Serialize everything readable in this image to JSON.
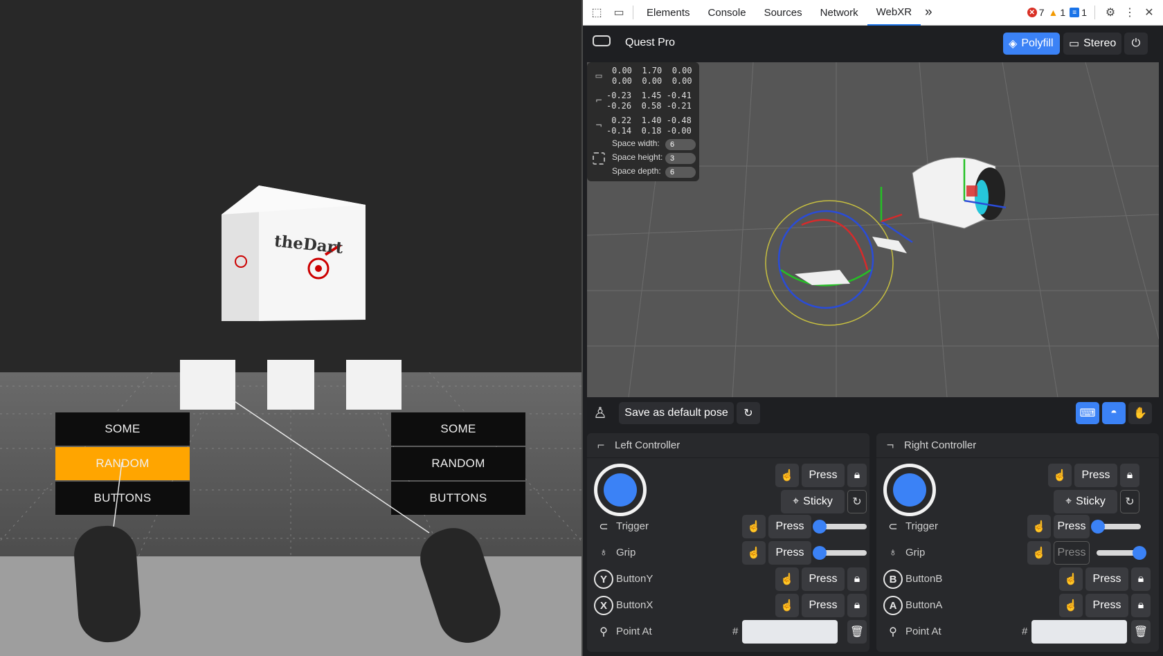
{
  "scene": {
    "buttons_left": [
      "SOME",
      "RANDOM",
      "BUTTONS"
    ],
    "buttons_right": [
      "SOME",
      "RANDOM",
      "BUTTONS"
    ],
    "highlight_color": "#ffa500",
    "cube_logo_text": "theDart"
  },
  "toolbar": {
    "tabs": [
      "Elements",
      "Console",
      "Sources",
      "Network",
      "WebXR"
    ],
    "active_tab": "WebXR",
    "more_label": "»",
    "errors": "7",
    "warnings": "1",
    "messages": "1"
  },
  "device": {
    "name": "Quest Pro",
    "polyfill_label": "Polyfill",
    "stereo_label": "Stereo"
  },
  "pose": {
    "headset": [
      "0.00  1.70  0.00",
      "0.00  0.00  0.00"
    ],
    "left_controller": [
      "-0.23  1.45 -0.41",
      "-0.26  0.58 -0.21"
    ],
    "right_controller": [
      " 0.22  1.40 -0.48",
      "-0.14  0.18 -0.00"
    ],
    "space_width_label": "Space width:",
    "space_width": "6",
    "space_height_label": "Space height:",
    "space_height": "3",
    "space_depth_label": "Space depth:",
    "space_depth": "6"
  },
  "posebar": {
    "save_label": "Save as default pose"
  },
  "left": {
    "title": "Left Controller",
    "press": "Press",
    "sticky": "Sticky",
    "trigger": "Trigger",
    "grip": "Grip",
    "button1": "ButtonY",
    "button1_glyph": "Y",
    "button2": "ButtonX",
    "button2_glyph": "X",
    "point_at": "Point At",
    "hash": "#",
    "trigger_value": 0,
    "grip_value": 0
  },
  "right": {
    "title": "Right Controller",
    "press": "Press",
    "sticky": "Sticky",
    "trigger": "Trigger",
    "grip": "Grip",
    "button1": "ButtonB",
    "button1_glyph": "B",
    "button2": "ButtonA",
    "button2_glyph": "A",
    "point_at": "Point At",
    "hash": "#",
    "trigger_value": 0,
    "grip_value": 1
  },
  "colors": {
    "accent": "#3b82f6",
    "panel": "#28292c",
    "background": "#1e1f22"
  }
}
